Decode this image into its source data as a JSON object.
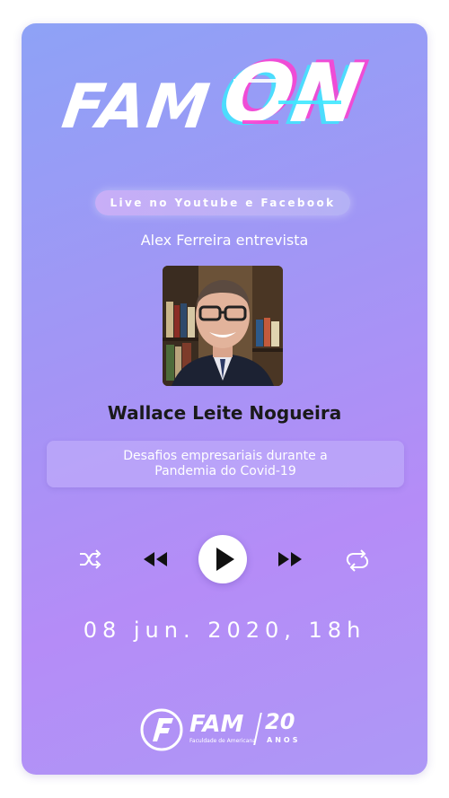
{
  "logo": {
    "fam": "FAM",
    "on": "ON"
  },
  "pill_text": "Live no Youtube e Facebook",
  "interviewer_text": "Alex Ferreira entrevista",
  "guest_name": "Wallace Leite Nogueira",
  "topic": {
    "line1": "Desafios empresariais durante a",
    "line2": "Pandemia do Covid-19"
  },
  "controls": [
    "shuffle-icon",
    "rewind-icon",
    "play-icon",
    "fast-forward-icon",
    "repeat-icon"
  ],
  "date_text": "08 jun. 2020, 18h",
  "footer": {
    "brand": "FAM",
    "subtitle": "Faculdade de Americana",
    "years": "20",
    "years_label": "ANOS"
  },
  "colors": {
    "gradient_start": "#8ea2f6",
    "gradient_end": "#b58cf7",
    "glitch_cyan": "#3fe8ff",
    "glitch_magenta": "#ff3fd1"
  }
}
